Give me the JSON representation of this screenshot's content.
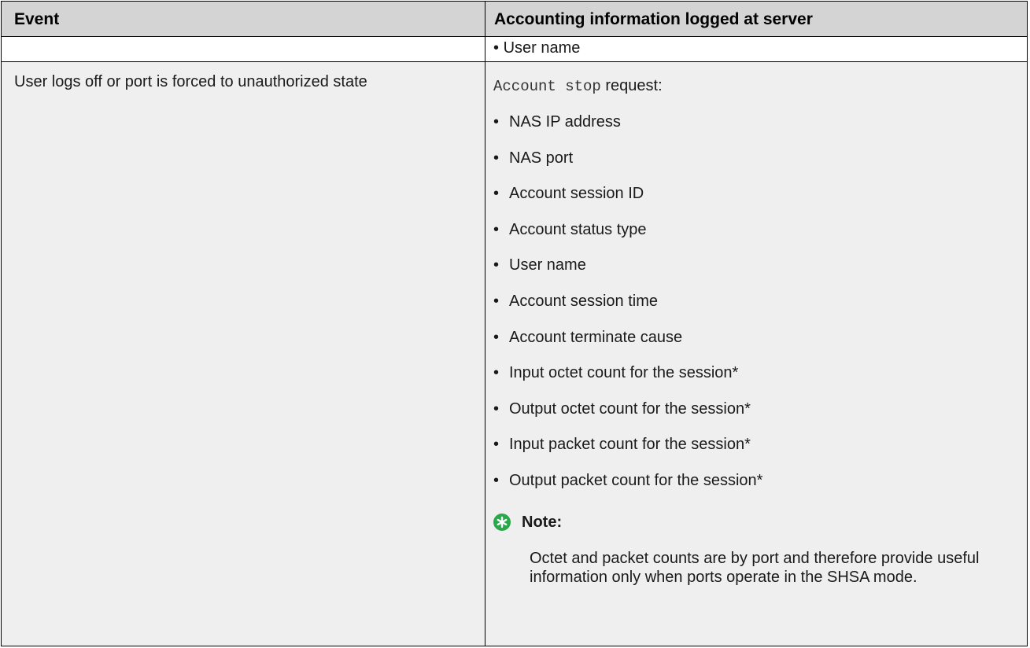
{
  "table": {
    "headers": {
      "event": "Event",
      "accounting": "Accounting information logged at server"
    },
    "continuation_item": "User name",
    "row": {
      "event": "User logs off or port is forced to unauthorized state",
      "request_code": "Account stop",
      "request_suffix": " request:",
      "items": [
        "NAS IP address",
        "NAS port",
        "Account session ID",
        "Account status type",
        "User name",
        "Account session time",
        "Account terminate cause",
        "Input octet count for the session*",
        "Output octet count for the session*",
        "Input packet count for the session*",
        "Output packet count for the session*"
      ],
      "note": {
        "icon": "star-note-icon",
        "icon_color": "#2aa84a",
        "title": "Note:",
        "text": "Octet and packet counts are by port and therefore provide useful information only when ports operate in the SHSA mode."
      }
    }
  },
  "colors": {
    "header_bg": "#d4d4d4",
    "row_bg": "#efefef",
    "border": "#000000"
  }
}
